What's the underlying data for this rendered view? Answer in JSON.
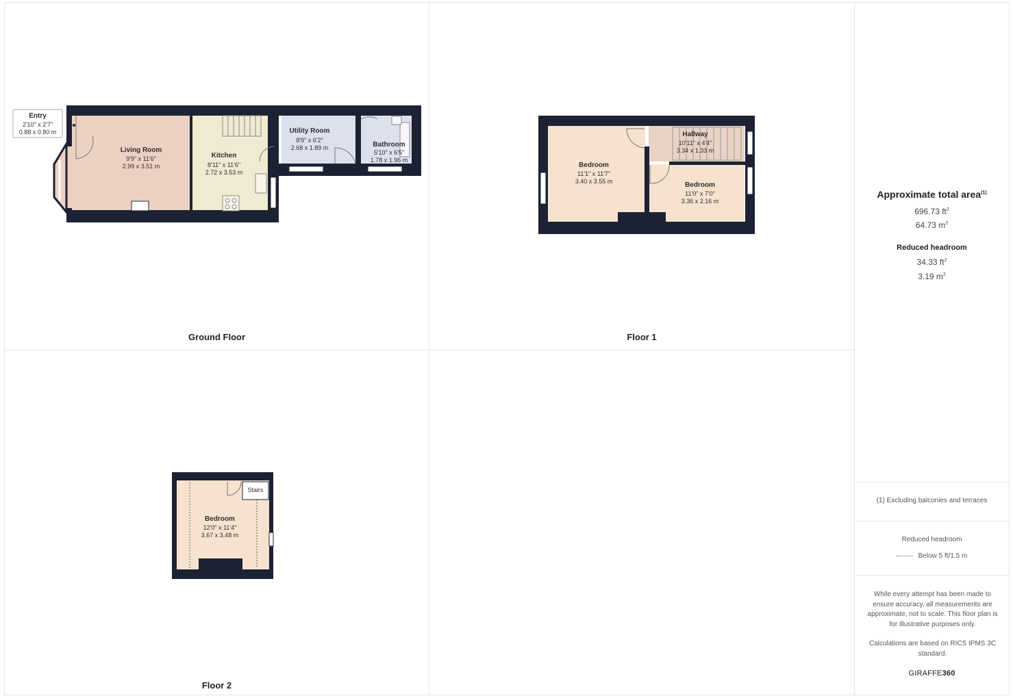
{
  "floors": {
    "ground": {
      "label": "Ground Floor",
      "rooms": {
        "entry": {
          "name": "Entry",
          "imperial": "2'10\" x 2'7\"",
          "metric": "0.88 x 0.80 m"
        },
        "living": {
          "name": "Living Room",
          "imperial": "9'9\" x 11'6\"",
          "metric": "2.99 x 3.51 m"
        },
        "kitchen": {
          "name": "Kitchen",
          "imperial": "8'11\" x 11'6\"",
          "metric": "2.72 x 3.53 m"
        },
        "utility": {
          "name": "Utility Room",
          "imperial": "8'9\" x 6'2\"",
          "metric": "2.68 x 1.89 m"
        },
        "bathroom": {
          "name": "Bathroom",
          "imperial": "5'10\" x 6'5\"",
          "metric": "1.78 x 1.96 m"
        }
      }
    },
    "floor1": {
      "label": "Floor 1",
      "rooms": {
        "bedroom1": {
          "name": "Bedroom",
          "imperial": "11'1\" x 11'7\"",
          "metric": "3.40 x 3.55 m"
        },
        "hallway": {
          "name": "Hallway",
          "imperial": "10'11\" x 4'4\"",
          "metric": "3.34 x 1.33 m"
        },
        "bedroom2": {
          "name": "Bedroom",
          "imperial": "11'0\" x 7'0\"",
          "metric": "3.36 x 2.16 m"
        }
      }
    },
    "floor2": {
      "label": "Floor 2",
      "rooms": {
        "bedroom": {
          "name": "Bedroom",
          "imperial": "12'0\" x 11'4\"",
          "metric": "3.67 x 3.48 m"
        },
        "stairs": {
          "name": "Stairs"
        }
      }
    }
  },
  "summary": {
    "total_title": "Approximate total area",
    "footnote_mark": "(1)",
    "total_ft": "696.73 ft",
    "total_m": "64.73 m",
    "reduced_title": "Reduced headroom",
    "reduced_ft": "34.33 ft",
    "reduced_m": "3.19 m",
    "unit_power": "2",
    "footnote": "(1) Excluding balconies and terraces",
    "legend_title": "Reduced headroom",
    "legend_text": "Below 5 ft/1.5 m",
    "disclaimer_1": "While every attempt has been made to ensure accuracy, all measurements are approximate, not to scale. This floor plan is for illustrative purposes only.",
    "disclaimer_2": "Calculations are based on RICS IPMS 3C standard.",
    "brand_a": "GIRAFFE",
    "brand_b": "360"
  },
  "colors": {
    "wall": "#1c2233",
    "living": "#ecd1c3",
    "kitchen": "#efead2",
    "utility": "#dde1ee",
    "bedroom": "#f6e2cf",
    "hallway": "#e9d3c4"
  }
}
